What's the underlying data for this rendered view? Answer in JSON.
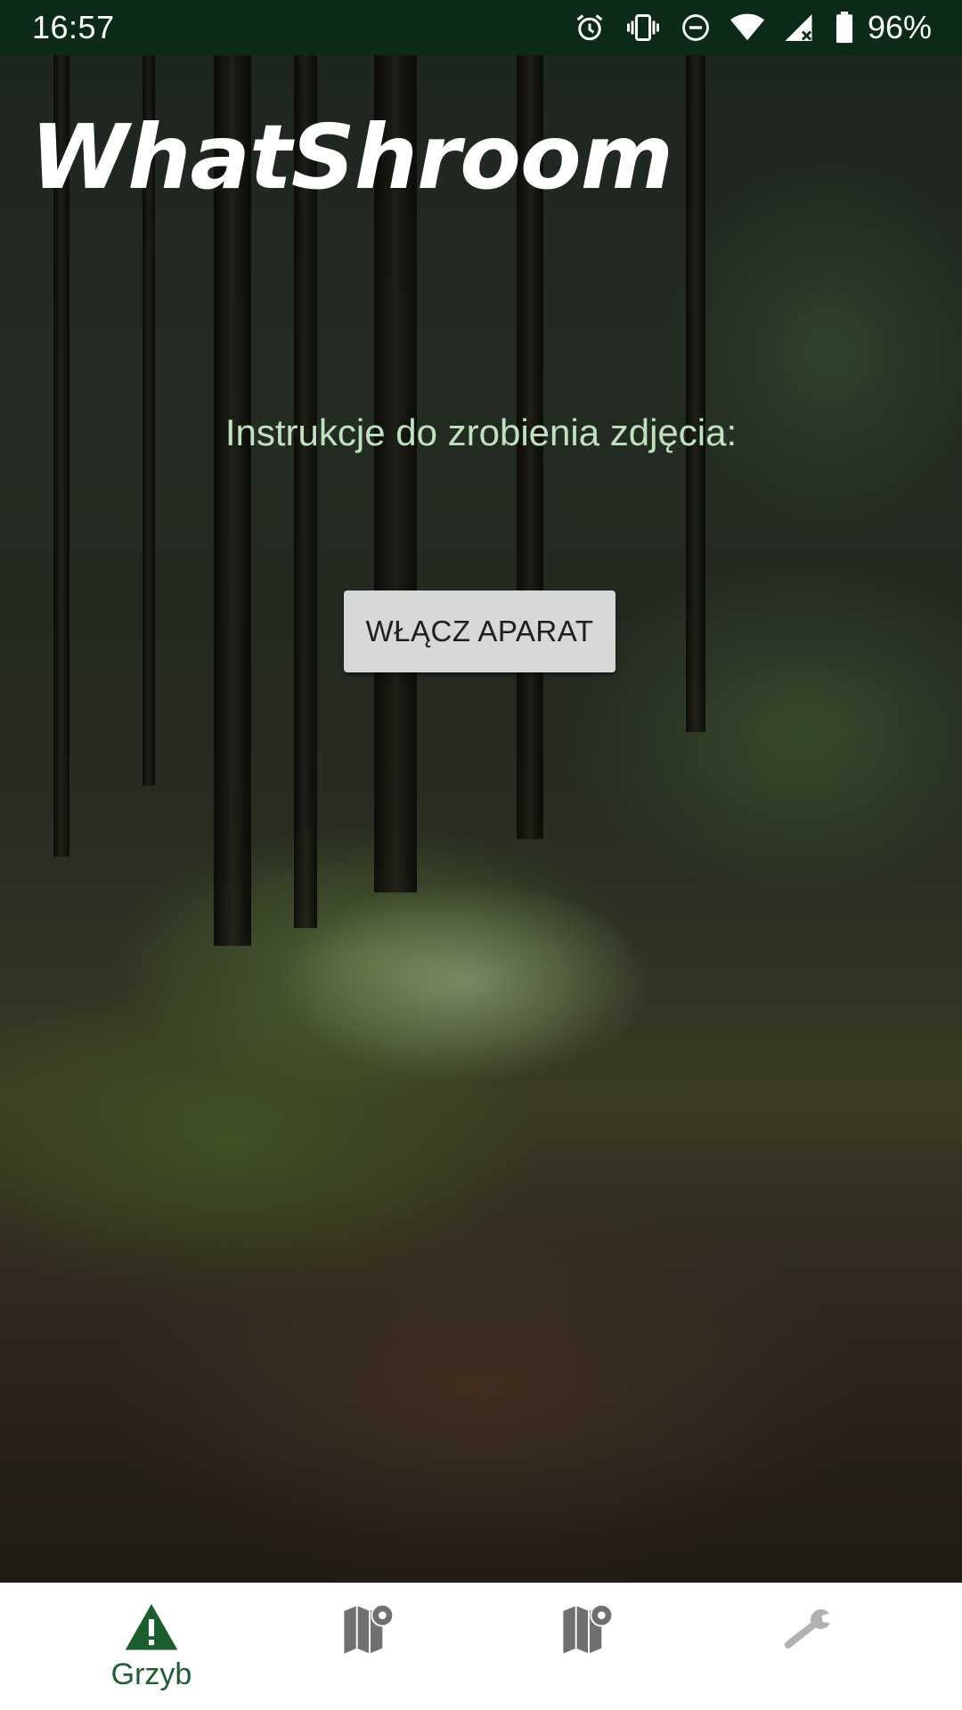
{
  "status_bar": {
    "time": "16:57",
    "battery": "96%",
    "icons": [
      "alarm-icon",
      "vibrate-icon",
      "do-not-disturb-icon",
      "wifi-icon",
      "signal-icon",
      "battery-icon"
    ]
  },
  "app": {
    "title": "WhatShroom"
  },
  "main": {
    "instructions": "Instrukcje do zrobienia zdjęcia:",
    "camera_button_label": "WŁĄCZ APARAT"
  },
  "bottom_nav": {
    "items": [
      {
        "label": "Grzyb",
        "icon": "warning-icon",
        "active": true
      },
      {
        "label": "",
        "icon": "map-pin-icon",
        "active": false
      },
      {
        "label": "",
        "icon": "map-pin-icon",
        "active": false
      },
      {
        "label": "",
        "icon": "wrench-icon",
        "active": false
      }
    ]
  },
  "colors": {
    "status_bar": "#0b2a17",
    "accent": "#1b5e2e",
    "instructions_text": "#bfe3bf",
    "button_bg": "#d6d7d7",
    "inactive_icon": "#707070",
    "disabled_icon": "#b0b0b0"
  }
}
